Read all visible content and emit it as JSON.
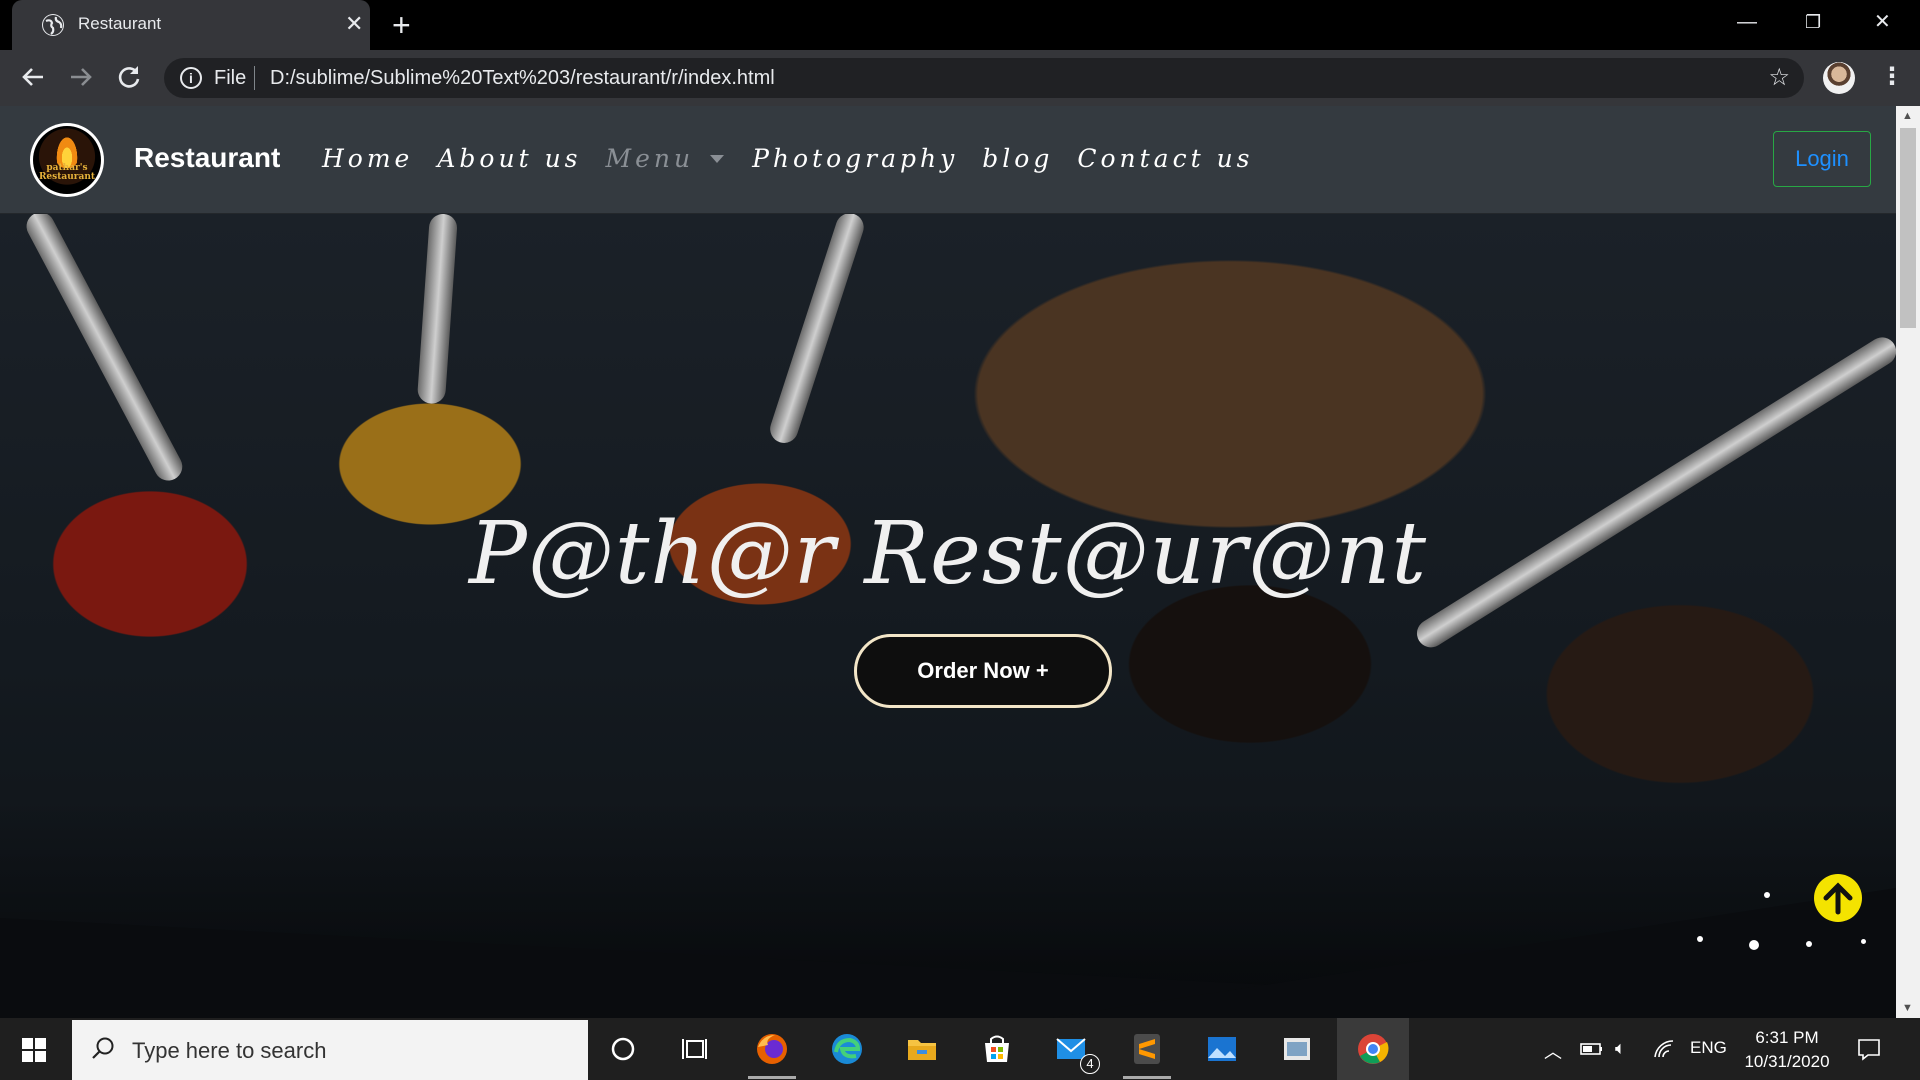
{
  "browser": {
    "tab_title": "Restaurant",
    "new_tab_symbol": "+",
    "url_scheme_label": "File",
    "url": "D:/sublime/Sublime%20Text%203/restaurant/r/index.html"
  },
  "site": {
    "brand": "Restaurant",
    "logo_text": "pathar's Restaurant",
    "nav": [
      "Home",
      "About us",
      "Menu",
      "Photography",
      "blog",
      "Contact us"
    ],
    "login_label": "Login"
  },
  "hero": {
    "title": "P@th@r Rest@ur@nt",
    "cta_label": "Order Now +"
  },
  "taskbar": {
    "search_placeholder": "Type here to search",
    "mail_badge": "4",
    "language": "ENG",
    "time": "6:31 PM",
    "date": "10/31/2020"
  },
  "colors": {
    "navbar": "#343a40",
    "login_border": "#28a745",
    "login_text": "#1e90ff",
    "scroll_top_button": "#f4e300",
    "cta_border": "#f3e6c8"
  }
}
